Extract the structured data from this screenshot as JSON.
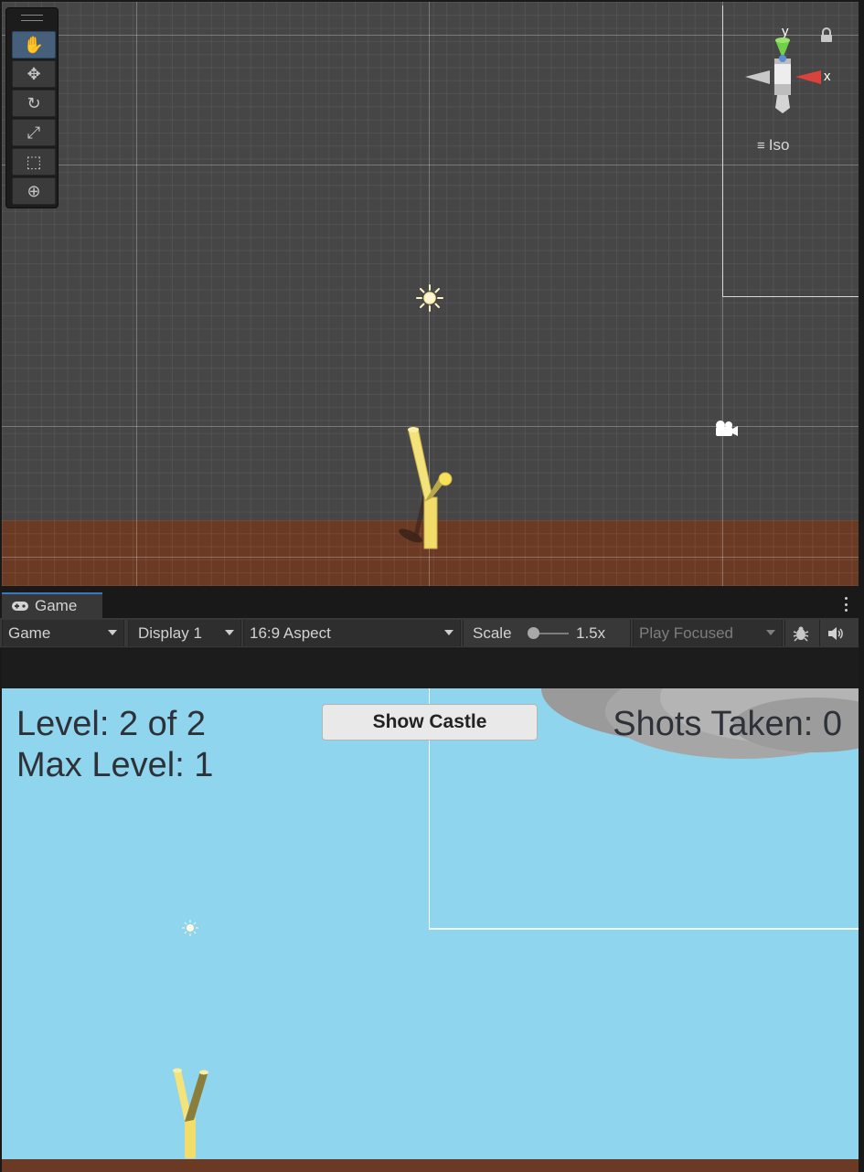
{
  "scene_view": {
    "tools": [
      {
        "name": "hand-tool",
        "glyph": "✋",
        "active": true
      },
      {
        "name": "move-tool",
        "glyph": "✥",
        "active": false
      },
      {
        "name": "rotate-tool",
        "glyph": "↻",
        "active": false
      },
      {
        "name": "scale-tool",
        "glyph": "⤢",
        "active": false
      },
      {
        "name": "rect-tool",
        "glyph": "⬚",
        "active": false
      },
      {
        "name": "transform-tool",
        "glyph": "⊕",
        "active": false
      }
    ],
    "gizmo": {
      "y_label": "y",
      "x_label": "x",
      "projection": "Iso"
    }
  },
  "game_panel": {
    "tab_label": "Game",
    "toolbar": {
      "mode": "Game",
      "display": "Display 1",
      "aspect": "16:9 Aspect",
      "scale_label": "Scale",
      "scale_value": "1.5x",
      "play_mode": "Play Focused"
    }
  },
  "game_hud": {
    "level": "Level: 2 of 2",
    "max_level": "Max Level: 1",
    "shots": "Shots Taken: 0",
    "show_castle_button": "Show Castle"
  },
  "colors": {
    "scene_background": "#464646",
    "ground": "#6b3a24",
    "sky": "#8fd5ee",
    "slingshot": "#f2dc6a",
    "tab_accent": "#3a79bb"
  }
}
